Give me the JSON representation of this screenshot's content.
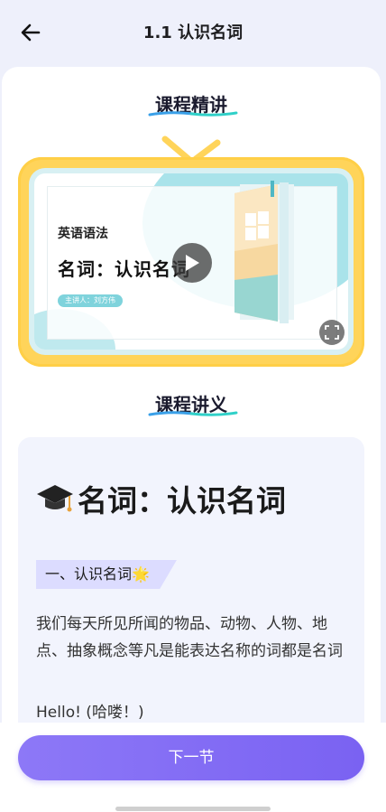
{
  "header": {
    "title": "1.1 认识名词"
  },
  "sections": {
    "lecture_title": "课程精讲",
    "notes_title": "课程讲义"
  },
  "video": {
    "slide_subtitle": "英语语法",
    "slide_title": "名词：认识名词",
    "slide_presenter": "主讲人：刘方伟"
  },
  "notes": {
    "heading": "名词：认识名词",
    "tag": "一、认识名词",
    "tag_emoji": "🌟",
    "body": "我们每天所见所闻的物品、动物、人物、地点、抽象概念等凡是能表达名称的词都是名词",
    "example": "Hello! (哈喽！)"
  },
  "footer": {
    "next_label": "下一节"
  },
  "colors": {
    "accent": "#7a62f2",
    "tv_frame": "#ffd45a",
    "underline_blue": "#3aa0e8",
    "underline_teal": "#2fd0c8"
  },
  "icons": [
    "back-arrow-icon",
    "play-icon",
    "fullscreen-icon",
    "graduation-cap-icon",
    "star-icon"
  ]
}
